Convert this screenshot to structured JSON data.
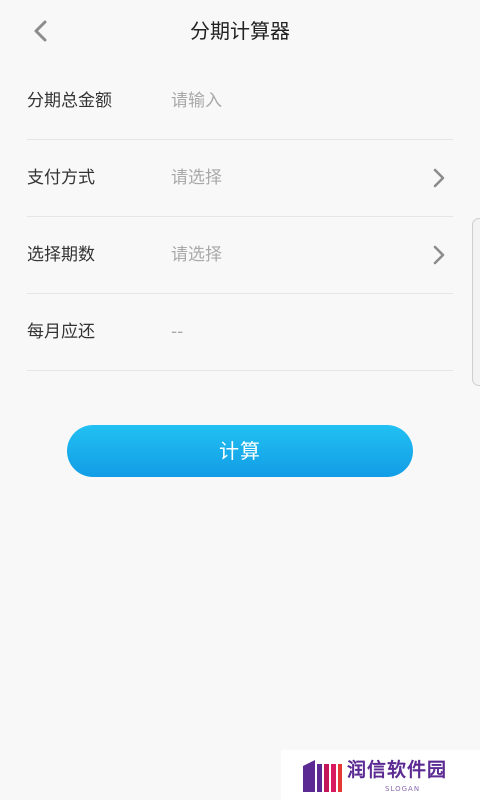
{
  "header": {
    "title": "分期计算器",
    "back_icon": "chevron-left-icon"
  },
  "form": {
    "rows": [
      {
        "label": "分期总金额",
        "placeholder": "请输入",
        "kind": "input"
      },
      {
        "label": "支付方式",
        "value": "请选择",
        "kind": "select",
        "icon": "chevron-right-icon"
      },
      {
        "label": "选择期数",
        "value": "请选择",
        "kind": "select",
        "icon": "chevron-right-icon"
      },
      {
        "label": "每月应还",
        "value": "--",
        "kind": "readonly"
      }
    ]
  },
  "calculate_button": {
    "label": "计算",
    "gradient_top": "#22c0f2",
    "gradient_bottom": "#129de6"
  },
  "watermark": {
    "name": "润信软件园",
    "slogan": "SLOGAN",
    "color": "#5b2a92"
  },
  "colors": {
    "background": "#f8f8f8",
    "label": "#333333",
    "placeholder": "#a9a9a9",
    "divider": "#e6e6e6"
  }
}
